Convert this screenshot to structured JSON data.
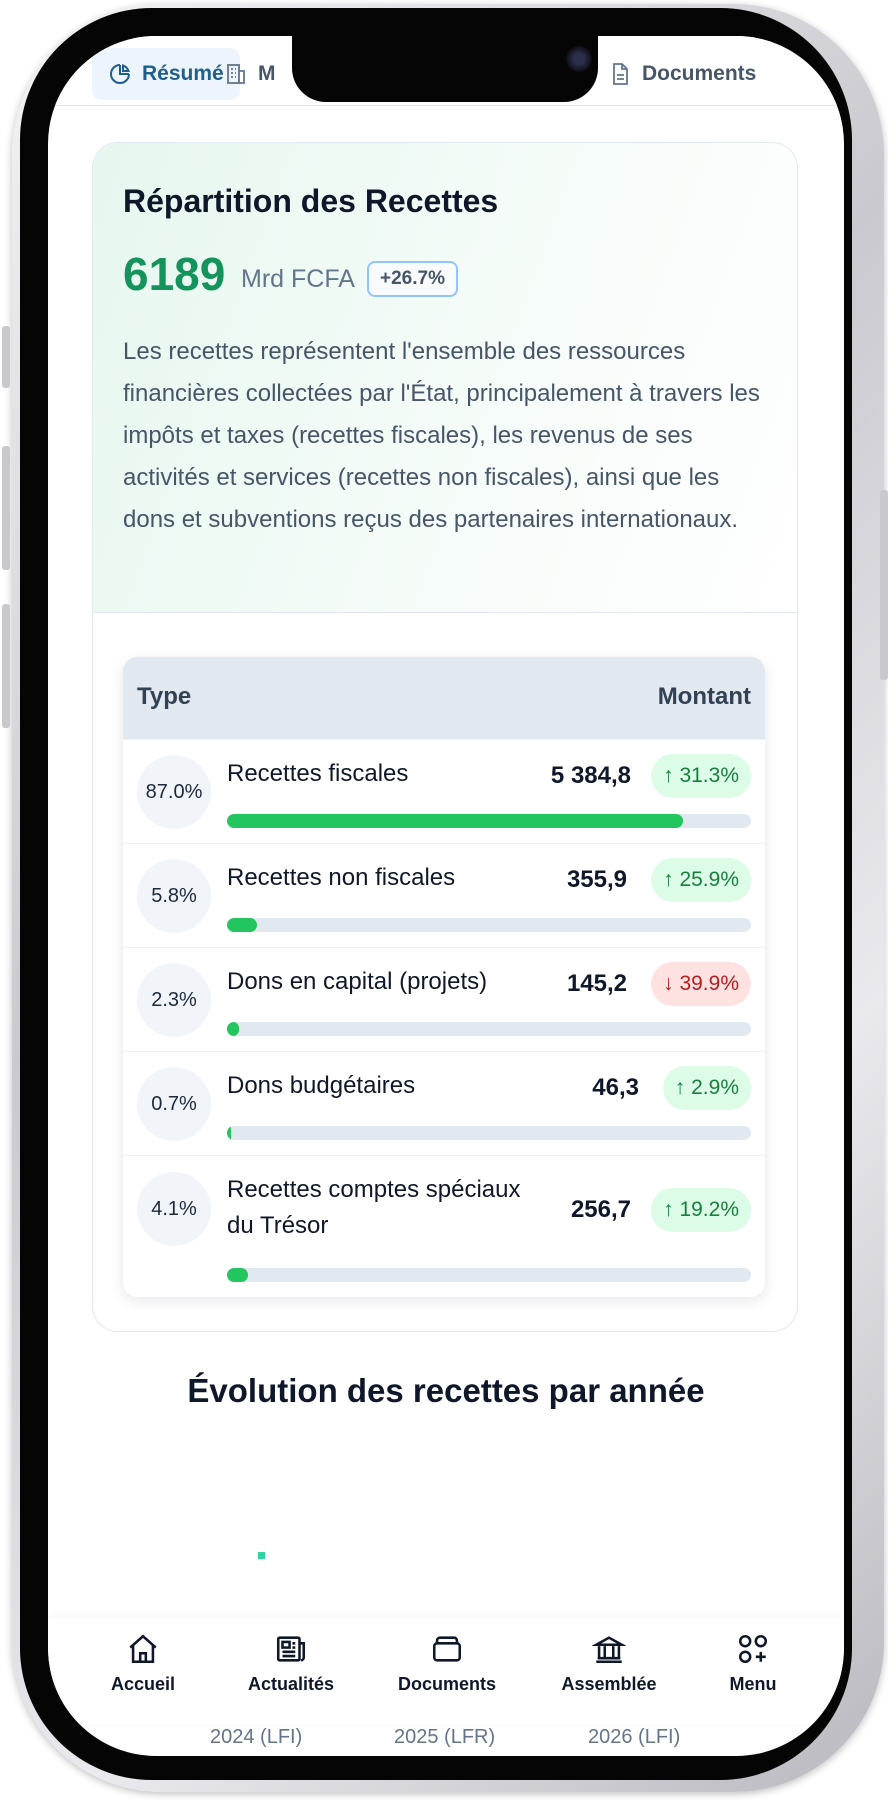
{
  "tabs": [
    {
      "label": "Résumé",
      "icon": "pie-chart-icon",
      "active": true
    },
    {
      "label": "M",
      "icon": "building-icon",
      "active": false
    },
    {
      "label": "Documents",
      "icon": "file-icon",
      "active": false
    }
  ],
  "summary": {
    "title": "Répartition des Recettes",
    "total": "6189",
    "unit": "Mrd FCFA",
    "change": "+26.7%",
    "description": "Les recettes représentent l'ensemble des ressources financières collectées par l'État, principalement à travers les impôts et taxes (recettes fiscales), les revenus de ses activités et services (recettes non fiscales), ainsi que les dons et subventions reçus des partenaires internationaux."
  },
  "table": {
    "col_type": "Type",
    "col_amount": "Montant",
    "rows": [
      {
        "pct": "87.0%",
        "label": "Recettes fiscales",
        "amount": "5 384,8",
        "change": "↑ 31.3%",
        "direction": "up",
        "share": 87.0
      },
      {
        "pct": "5.8%",
        "label": "Recettes non fiscales",
        "amount": "355,9",
        "change": "↑ 25.9%",
        "direction": "up",
        "share": 5.8
      },
      {
        "pct": "2.3%",
        "label": "Dons en capital (projets)",
        "amount": "145,2",
        "change": "↓ 39.9%",
        "direction": "down",
        "share": 2.3
      },
      {
        "pct": "0.7%",
        "label": "Dons budgétaires",
        "amount": "46,3",
        "change": "↑ 2.9%",
        "direction": "up",
        "share": 0.7
      },
      {
        "pct": "4.1%",
        "label": "Recettes comptes spéciaux du Trésor",
        "amount": "256,7",
        "change": "↑ 19.2%",
        "direction": "up",
        "share": 4.1
      }
    ]
  },
  "evolution": {
    "title": "Évolution des recettes par année",
    "years": [
      "2024 (LFI)",
      "2025 (LFR)",
      "2026 (LFI)"
    ]
  },
  "nav": [
    {
      "label": "Accueil",
      "icon": "home-icon"
    },
    {
      "label": "Actualités",
      "icon": "newspaper-icon"
    },
    {
      "label": "Documents",
      "icon": "folder-icon"
    },
    {
      "label": "Assemblée",
      "icon": "bank-icon"
    },
    {
      "label": "Menu",
      "icon": "grid-plus-icon"
    }
  ],
  "colors": {
    "accent_green": "#15935c",
    "bar_green": "#22c55e",
    "up_bg": "#dcfce7",
    "down_bg": "#fee2e2",
    "tab_active": "#1f5f8b"
  }
}
